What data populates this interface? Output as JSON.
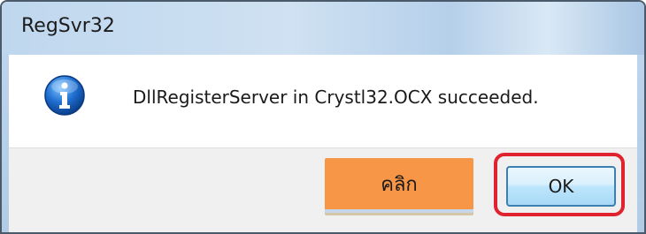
{
  "window": {
    "title": "RegSvr32"
  },
  "dialog": {
    "message": "DllRegisterServer in Crystl32.OCX succeeded.",
    "icon": "info-icon",
    "ok_label": "OK"
  },
  "annotation": {
    "label": "คลิก",
    "label_color": "#f79646",
    "highlight_color": "#e0232e"
  }
}
